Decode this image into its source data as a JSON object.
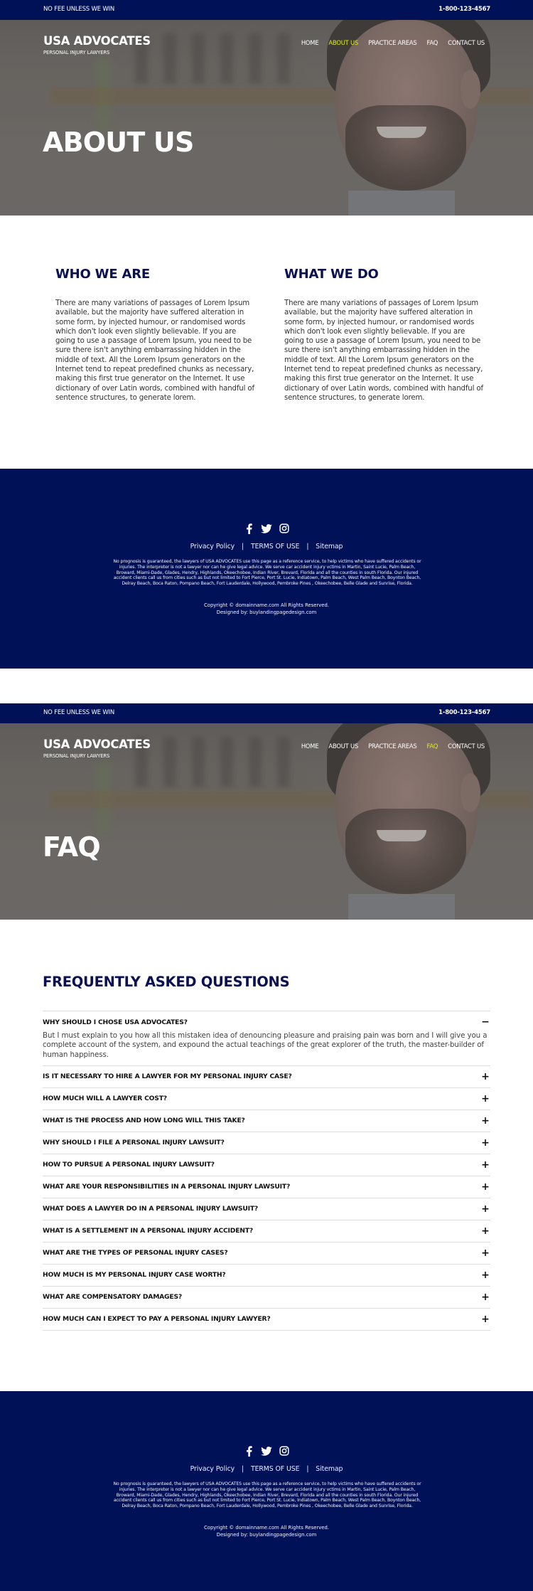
{
  "colors": {
    "navy": "#001158",
    "heading": "#0b1150",
    "accent": "#d6ee1f"
  },
  "topbar": {
    "tagline": "NO FEE UNLESS WE WIN",
    "phone": "1-800-123-4567"
  },
  "brand": {
    "name": "USA ADVOCATES",
    "subtitle": "PERSONAL INJURY LAWYERS"
  },
  "nav": [
    {
      "label": "HOME"
    },
    {
      "label": "ABOUT US"
    },
    {
      "label": "PRACTICE AREAS"
    },
    {
      "label": "FAQ"
    },
    {
      "label": "CONTACT US"
    }
  ],
  "about_page": {
    "active_nav": "ABOUT US",
    "hero_title": "ABOUT US",
    "columns": [
      {
        "heading": "WHO WE ARE",
        "text": "There are many variations of passages of Lorem Ipsum available, but the majority have suffered alteration in some form, by injected humour, or randomised words which don't look even slightly believable. If you are going to use a passage of Lorem Ipsum, you need to be sure there isn't anything embarrassing hidden in the middle of text. All the Lorem Ipsum generators on the Internet tend to repeat predefined chunks as necessary, making this first true generator on the Internet. It use dictionary of over Latin words, combined with handful of sentence structures, to generate lorem."
      },
      {
        "heading": "WHAT WE DO",
        "text": "There are many variations of passages of Lorem Ipsum available, but the majority have suffered alteration in some form, by injected humour, or randomised words which don't look even slightly believable. If you are going to use a passage of Lorem Ipsum, you need to be sure there isn't anything embarrassing hidden in the middle of text. All the Lorem Ipsum generators on the Internet tend to repeat predefined chunks as necessary, making this first true generator on the Internet. It use dictionary of over Latin words, combined with handful of sentence structures, to generate lorem."
      }
    ]
  },
  "faq_page": {
    "active_nav": "FAQ",
    "hero_title": "FAQ",
    "heading": "FREQUENTLY ASKED QUESTIONS",
    "items": [
      {
        "question": "WHY SHOULD I CHOSE USA ADVOCATES?",
        "expanded": true,
        "answer": "But I must explain to you how all this mistaken idea of denouncing pleasure and praising pain was born and I will give you a complete account of the system, and expound the actual teachings of the great explorer of the truth, the master-builder of human happiness."
      },
      {
        "question": "IS IT NECESSARY TO HIRE A LAWYER FOR MY PERSONAL INJURY CASE?",
        "expanded": false
      },
      {
        "question": "HOW MUCH WILL A LAWYER COST?",
        "expanded": false
      },
      {
        "question": "WHAT IS THE PROCESS AND HOW LONG WILL THIS TAKE?",
        "expanded": false
      },
      {
        "question": "WHY SHOULD I FILE A PERSONAL INJURY LAWSUIT?",
        "expanded": false
      },
      {
        "question": "HOW TO PURSUE A PERSONAL INJURY LAWSUIT?",
        "expanded": false
      },
      {
        "question": "WHAT ARE YOUR RESPONSIBILITIES IN A PERSONAL INJURY LAWSUIT?",
        "expanded": false
      },
      {
        "question": "WHAT DOES A LAWYER DO IN A PERSONAL INJURY LAWSUIT?",
        "expanded": false
      },
      {
        "question": "WHAT IS A SETTLEMENT IN A PERSONAL INJURY ACCIDENT?",
        "expanded": false
      },
      {
        "question": "WHAT ARE THE TYPES OF PERSONAL INJURY CASES?",
        "expanded": false
      },
      {
        "question": "HOW MUCH IS MY PERSONAL INJURY CASE WORTH?",
        "expanded": false
      },
      {
        "question": "WHAT ARE COMPENSATORY DAMAGES?",
        "expanded": false
      },
      {
        "question": "HOW MUCH CAN I EXPECT TO PAY A PERSONAL INJURY LAWYER?",
        "expanded": false
      }
    ],
    "icons": {
      "expanded": "−",
      "collapsed": "+"
    }
  },
  "footer": {
    "social": [
      {
        "name": "facebook-icon"
      },
      {
        "name": "twitter-icon"
      },
      {
        "name": "instagram-icon"
      }
    ],
    "links": [
      {
        "label": "Privacy Policy"
      },
      {
        "label": "TERMS OF USE"
      },
      {
        "label": "Sitemap"
      }
    ],
    "separator": "|",
    "disclaimer": "No prognosis is guaranteed, the lawyers of USA ADVOCATES use this page as a reference service, to help victims who have suffered accidents or injuries. The interpreter is not a lawyer nor can he give legal advice. We serve car accident injury vctims in Martin, Saint Lucie, Palm Beach, Broward, Miami-Dade, Glades, Hendry, Highlands, Okeechobee, Indian River, Brevard, Florida and all the counties in south Florida. Our injured accident clients call us from cities such as but not limited to Fort Pierce, Port St. Lucie, Indiatown, Palm Beach, West Palm Beach, Boynton Beach, Delray Beach, Boca Raton, Pompano Beach, Fort Lauderdale, Hollywood, Pembroke Pines , Okeechobee, Belle Glade and Sunrise, Florida.",
    "copyright": "Copyright © domainname.com All Rights Reserved.",
    "designed_by": "Designed by: buylandingpagedesign.com"
  }
}
